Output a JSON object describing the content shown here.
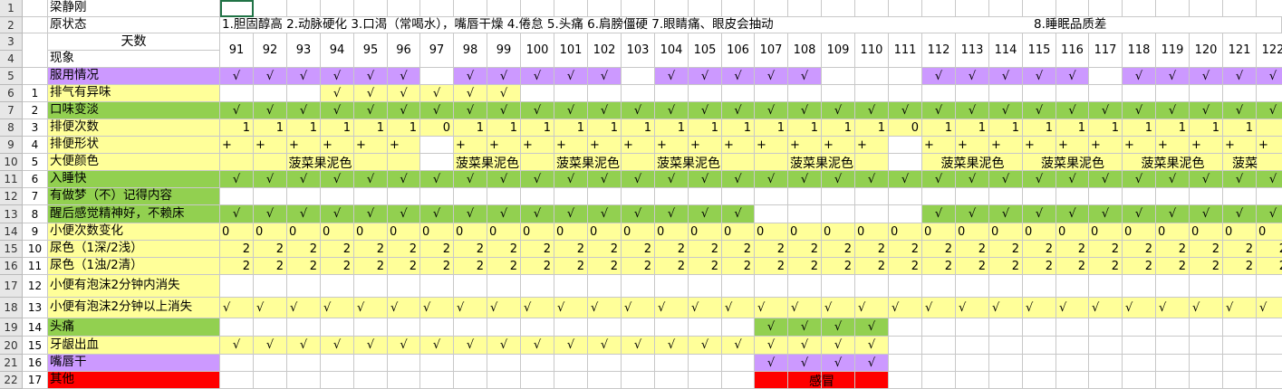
{
  "header": {
    "name": "梁静刚",
    "status_label": "原状态",
    "status_text": "1.胆固醇高   2.动脉硬化   3.口渴（常喝水），嘴唇干燥   4.倦怠  5.头痛  6.肩膀僵硬 7.眼睛痛、眼皮会抽动",
    "status_text2": "8.睡眠品质差",
    "days_label": "天数",
    "phenomenon_label": "现象"
  },
  "row_numbers": [
    "1",
    "2",
    "3",
    "4",
    "5",
    "6",
    "7",
    "8",
    "9",
    "10",
    "11",
    "12",
    "13",
    "14",
    "15",
    "16",
    "17",
    "18",
    "19",
    "20",
    "21",
    "22"
  ],
  "days": [
    "91",
    "92",
    "93",
    "94",
    "95",
    "96",
    "97",
    "98",
    "99",
    "100",
    "101",
    "102",
    "103",
    "104",
    "105",
    "106",
    "107",
    "108",
    "109",
    "110",
    "111",
    "112",
    "113",
    "114",
    "115",
    "116",
    "117",
    "118",
    "119",
    "120",
    "121",
    "122"
  ],
  "colors": {
    "purple": "#cc99ff",
    "yellow": "#ffff99",
    "green": "#92d050",
    "red": "#ff0000",
    "white": "#ffffff"
  },
  "rows": [
    {
      "seq": "",
      "label": "服用情况",
      "color": "purple",
      "cells": [
        "√",
        "√",
        "√",
        "√",
        "√",
        "√",
        "",
        "√",
        "√",
        "√",
        "√",
        "√",
        "",
        "√",
        "√",
        "√",
        "√",
        "√",
        "",
        "",
        "",
        "√",
        "√",
        "√",
        "√",
        "√",
        "",
        "√",
        "√",
        "√",
        "√",
        "√"
      ],
      "colors": [
        "purple",
        "purple",
        "purple",
        "purple",
        "purple",
        "purple",
        "white",
        "purple",
        "purple",
        "purple",
        "purple",
        "purple",
        "white",
        "purple",
        "purple",
        "purple",
        "purple",
        "purple",
        "white",
        "white",
        "white",
        "purple",
        "purple",
        "purple",
        "purple",
        "purple",
        "white",
        "purple",
        "purple",
        "purple",
        "purple",
        "purple"
      ]
    },
    {
      "seq": "1",
      "label": "排气有异味",
      "color": "yellow",
      "cells": [
        "",
        "",
        "",
        "√",
        "√",
        "√",
        "√",
        "√",
        "√",
        "",
        "",
        "",
        "",
        "",
        "",
        "",
        "",
        "",
        "",
        "",
        "",
        "",
        "",
        "",
        "",
        "",
        "",
        "",
        "",
        "",
        "",
        ""
      ],
      "colors": [
        "white",
        "white",
        "white",
        "yellow",
        "yellow",
        "yellow",
        "yellow",
        "yellow",
        "yellow",
        "white",
        "white",
        "white",
        "white",
        "white",
        "white",
        "white",
        "white",
        "white",
        "white",
        "white",
        "white",
        "white",
        "white",
        "white",
        "white",
        "white",
        "white",
        "white",
        "white",
        "white",
        "white",
        "white"
      ]
    },
    {
      "seq": "2",
      "label": "口味变淡",
      "color": "green",
      "cells": [
        "√",
        "√",
        "√",
        "√",
        "√",
        "√",
        "√",
        "√",
        "√",
        "√",
        "√",
        "√",
        "√",
        "√",
        "√",
        "√",
        "√",
        "√",
        "√",
        "√",
        "√",
        "√",
        "√",
        "√",
        "√",
        "√",
        "√",
        "√",
        "√",
        "√",
        "√",
        "√"
      ],
      "colors": "green"
    },
    {
      "seq": "3",
      "label": "排便次数",
      "color": "yellow",
      "cells": [
        "1",
        "1",
        "1",
        "1",
        "1",
        "1",
        "0",
        "1",
        "1",
        "1",
        "1",
        "1",
        "1",
        "1",
        "1",
        "1",
        "1",
        "1",
        "1",
        "1",
        "0",
        "1",
        "1",
        "1",
        "1",
        "1",
        "1",
        "1",
        "1",
        "1",
        "1",
        ""
      ],
      "colors": "yellow",
      "type": "num"
    },
    {
      "seq": "4",
      "label": "排便形状",
      "color": "yellow",
      "cells": [
        "+",
        "+",
        "+",
        "+",
        "+",
        "+",
        "",
        "+",
        "+",
        "+",
        "+",
        "+",
        "+",
        "+",
        "+",
        "+",
        "+",
        "+",
        "+",
        "+",
        "",
        "+",
        "+",
        "+",
        "+",
        "+",
        "+",
        "+",
        "+",
        "+",
        "+",
        "+"
      ],
      "colors": [
        "yellow",
        "yellow",
        "yellow",
        "yellow",
        "yellow",
        "yellow",
        "white",
        "yellow",
        "yellow",
        "yellow",
        "yellow",
        "yellow",
        "yellow",
        "yellow",
        "yellow",
        "yellow",
        "yellow",
        "yellow",
        "yellow",
        "yellow",
        "white",
        "yellow",
        "yellow",
        "yellow",
        "yellow",
        "yellow",
        "yellow",
        "yellow",
        "yellow",
        "yellow",
        "yellow",
        "yellow"
      ],
      "type": "plus"
    },
    {
      "seq": "5",
      "label": "大便颜色",
      "color": "yellow",
      "cells": [
        "",
        "",
        "",
        "",
        "",
        "",
        "",
        "",
        "",
        "",
        "",
        "",
        "",
        "",
        "",
        "",
        "",
        "",
        "",
        "",
        "",
        "",
        "",
        "",
        "",
        "",
        "",
        "",
        "",
        "",
        "",
        ""
      ],
      "colors": [
        "yellow",
        "yellow",
        "yellow",
        "yellow",
        "yellow",
        "yellow",
        "white",
        "yellow",
        "yellow",
        "yellow",
        "yellow",
        "yellow",
        "yellow",
        "yellow",
        "yellow",
        "yellow",
        "yellow",
        "yellow",
        "yellow",
        "yellow",
        "white",
        "yellow",
        "yellow",
        "yellow",
        "yellow",
        "yellow",
        "yellow",
        "yellow",
        "yellow",
        "yellow",
        "yellow",
        "yellow"
      ],
      "spans": [
        {
          "from": 0,
          "to": 5,
          "text": "菠菜果泥色"
        },
        {
          "from": 7,
          "to": 8,
          "text": "菠菜果泥色"
        },
        {
          "from": 10,
          "to": 11,
          "text": "菠菜果泥色"
        },
        {
          "from": 13,
          "to": 14,
          "text": "菠菜果泥色"
        },
        {
          "from": 16,
          "to": 19,
          "text": "菠菜果泥色"
        },
        {
          "from": 21,
          "to": 23,
          "text": "菠菜果泥色"
        },
        {
          "from": 24,
          "to": 26,
          "text": "菠菜果泥色"
        },
        {
          "from": 27,
          "to": 29,
          "text": "菠菜果泥色"
        },
        {
          "from": 30,
          "to": 31,
          "text": "菠菜"
        }
      ]
    },
    {
      "seq": "6",
      "label": "入睡快",
      "color": "green",
      "cells": [
        "√",
        "√",
        "√",
        "√",
        "√",
        "√",
        "√",
        "√",
        "√",
        "√",
        "√",
        "√",
        "√",
        "√",
        "√",
        "√",
        "√",
        "√",
        "√",
        "√",
        "√",
        "√",
        "√",
        "√",
        "√",
        "√",
        "√",
        "√",
        "√",
        "√",
        "√",
        "√"
      ],
      "colors": "green"
    },
    {
      "seq": "7",
      "label": "有做梦（不）记得内容",
      "color": "green",
      "cells": [
        "",
        "",
        "",
        "",
        "",
        "",
        "",
        "",
        "",
        "",
        "",
        "",
        "",
        "",
        "",
        "",
        "",
        "",
        "",
        "",
        "",
        "",
        "",
        "",
        "",
        "",
        "",
        "",
        "",
        "",
        "",
        ""
      ],
      "colors": "white"
    },
    {
      "seq": "8",
      "label": "醒后感觉精神好，不赖床",
      "color": "green",
      "cells": [
        "√",
        "√",
        "√",
        "√",
        "√",
        "√",
        "√",
        "√",
        "√",
        "√",
        "√",
        "√",
        "√",
        "√",
        "√",
        "√",
        "",
        "",
        "",
        "",
        "",
        "√",
        "√",
        "√",
        "√",
        "√",
        "√",
        "√",
        "√",
        "√",
        "√",
        "√"
      ],
      "colors": [
        "green",
        "green",
        "green",
        "green",
        "green",
        "green",
        "green",
        "green",
        "green",
        "green",
        "green",
        "green",
        "green",
        "green",
        "green",
        "green",
        "white",
        "white",
        "white",
        "white",
        "white",
        "green",
        "green",
        "green",
        "green",
        "green",
        "green",
        "green",
        "green",
        "green",
        "green",
        "green"
      ],
      "label_span": 16
    },
    {
      "seq": "9",
      "label": "小便次数变化",
      "color": "yellow",
      "cells": [
        "0",
        "0",
        "0",
        "0",
        "0",
        "0",
        "0",
        "0",
        "0",
        "0",
        "0",
        "0",
        "0",
        "0",
        "0",
        "0",
        "0",
        "0",
        "0",
        "0",
        "0",
        "0",
        "0",
        "0",
        "0",
        "0",
        "0",
        "0",
        "0",
        "0",
        "0",
        "0"
      ],
      "colors": "yellow",
      "type": "plus"
    },
    {
      "seq": "10",
      "label": "尿色（1深/2浅）",
      "color": "yellow",
      "cells": [
        "2",
        "2",
        "2",
        "2",
        "2",
        "2",
        "2",
        "2",
        "2",
        "2",
        "2",
        "2",
        "2",
        "2",
        "2",
        "2",
        "2",
        "2",
        "2",
        "2",
        "2",
        "2",
        "2",
        "2",
        "2",
        "2",
        "2",
        "2",
        "2",
        "2",
        "2",
        "2"
      ],
      "colors": "yellow",
      "type": "num"
    },
    {
      "seq": "11",
      "label": "尿色（1浊/2清）",
      "color": "yellow",
      "cells": [
        "2",
        "2",
        "2",
        "2",
        "2",
        "2",
        "2",
        "2",
        "2",
        "2",
        "2",
        "2",
        "2",
        "2",
        "2",
        "2",
        "2",
        "2",
        "2",
        "2",
        "2",
        "2",
        "2",
        "2",
        "2",
        "2",
        "2",
        "2",
        "2",
        "2",
        "2",
        "2"
      ],
      "colors": "yellow",
      "type": "num"
    },
    {
      "seq": "12",
      "label": "小便有泡沫2分钟内消失",
      "color": "yellow",
      "cells": [
        "",
        "",
        "",
        "",
        "",
        "",
        "",
        "",
        "",
        "",
        "",
        "",
        "",
        "",
        "",
        "",
        "",
        "",
        "",
        "",
        "",
        "",
        "",
        "",
        "",
        "",
        "",
        "",
        "",
        "",
        "",
        ""
      ],
      "colors": "white"
    },
    {
      "seq": "13",
      "label": "小便有泡沫2分钟以上消失",
      "color": "yellow",
      "cells": [
        "√",
        "√",
        "√",
        "√",
        "√",
        "√",
        "√",
        "√",
        "√",
        "√",
        "√",
        "√",
        "√",
        "√",
        "√",
        "√",
        "√",
        "√",
        "√",
        "√",
        "√",
        "√",
        "√",
        "√",
        "√",
        "√",
        "√",
        "√",
        "√",
        "√",
        "√",
        "√"
      ],
      "colors": "yellow",
      "type": "chk-l"
    },
    {
      "seq": "14",
      "label": "头痛",
      "color": "green",
      "cells": [
        "",
        "",
        "",
        "",
        "",
        "",
        "",
        "",
        "",
        "",
        "",
        "",
        "",
        "",
        "",
        "",
        "√",
        "√",
        "√",
        "√",
        "",
        "",
        "",
        "",
        "",
        "",
        "",
        "",
        "",
        "",
        "",
        ""
      ],
      "colors": [
        "white",
        "white",
        "white",
        "white",
        "white",
        "white",
        "white",
        "white",
        "white",
        "white",
        "white",
        "white",
        "white",
        "white",
        "white",
        "white",
        "green",
        "green",
        "green",
        "green",
        "white",
        "white",
        "white",
        "white",
        "white",
        "white",
        "white",
        "white",
        "white",
        "white",
        "white",
        "white"
      ]
    },
    {
      "seq": "15",
      "label": "牙龈出血",
      "color": "yellow",
      "cells": [
        "√",
        "√",
        "√",
        "√",
        "√",
        "√",
        "√",
        "√",
        "√",
        "√",
        "√",
        "√",
        "√",
        "√",
        "√",
        "√",
        "√",
        "√",
        "√",
        "√",
        "",
        "",
        "",
        "",
        "",
        "",
        "",
        "",
        "",
        "",
        "",
        ""
      ],
      "colors": [
        "yellow",
        "yellow",
        "yellow",
        "yellow",
        "yellow",
        "yellow",
        "yellow",
        "yellow",
        "yellow",
        "yellow",
        "yellow",
        "yellow",
        "yellow",
        "yellow",
        "yellow",
        "yellow",
        "yellow",
        "yellow",
        "yellow",
        "yellow",
        "white",
        "white",
        "white",
        "white",
        "white",
        "white",
        "white",
        "white",
        "white",
        "white",
        "white",
        "white"
      ]
    },
    {
      "seq": "16",
      "label": "嘴唇干",
      "color": "purple",
      "cells": [
        "",
        "",
        "",
        "",
        "",
        "",
        "",
        "",
        "",
        "",
        "",
        "",
        "",
        "",
        "",
        "",
        "√",
        "√",
        "√",
        "√",
        "",
        "",
        "",
        "",
        "",
        "",
        "",
        "",
        "",
        "",
        "",
        ""
      ],
      "colors": [
        "white",
        "white",
        "white",
        "white",
        "white",
        "white",
        "white",
        "white",
        "white",
        "white",
        "white",
        "white",
        "white",
        "white",
        "white",
        "white",
        "purple",
        "purple",
        "purple",
        "purple",
        "white",
        "white",
        "white",
        "white",
        "white",
        "white",
        "white",
        "white",
        "white",
        "white",
        "white",
        "white"
      ]
    },
    {
      "seq": "17",
      "label": "其他",
      "color": "red",
      "cells": [
        "",
        "",
        "",
        "",
        "",
        "",
        "",
        "",
        "",
        "",
        "",
        "",
        "",
        "",
        "",
        "",
        "",
        "",
        "",
        "",
        "",
        "",
        "",
        "",
        "",
        "",
        "",
        "",
        "",
        "",
        "",
        ""
      ],
      "colors": [
        "white",
        "white",
        "white",
        "white",
        "white",
        "white",
        "white",
        "white",
        "white",
        "white",
        "white",
        "white",
        "white",
        "white",
        "white",
        "white",
        "red",
        "red",
        "red",
        "red",
        "white",
        "white",
        "white",
        "white",
        "white",
        "white",
        "white",
        "white",
        "white",
        "white",
        "white",
        "white"
      ],
      "spans": [
        {
          "from": 16,
          "to": 19,
          "text": "感冒"
        }
      ]
    }
  ]
}
